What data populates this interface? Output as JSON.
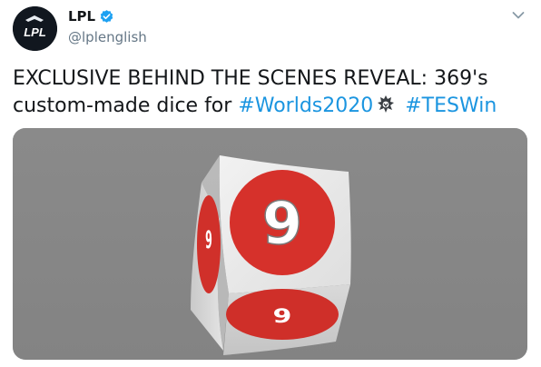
{
  "tweet": {
    "author": {
      "display_name": "LPL",
      "handle": "@lplenglish",
      "verified": true,
      "avatar_text": "LPL",
      "avatar_icon": "lpl-logo-icon"
    },
    "text_line1": "EXCLUSIVE BEHIND THE SCENES REVEAL: 369's",
    "text_line2_prefix": "custom-made dice for ",
    "hashtag1": "#Worlds2020",
    "hashtag2": "#TESWin",
    "emoji_icon": "worlds-logo-emoji-icon",
    "menu_icon": "chevron-down-icon",
    "media": {
      "description_icon": "dice-image",
      "die_number": "9"
    }
  },
  "colors": {
    "text": "#14171a",
    "secondary_text": "#657786",
    "link": "#1b95e0",
    "verified_badge": "#1da1f2",
    "die_red": "#d6312b",
    "media_background": "#878787"
  }
}
